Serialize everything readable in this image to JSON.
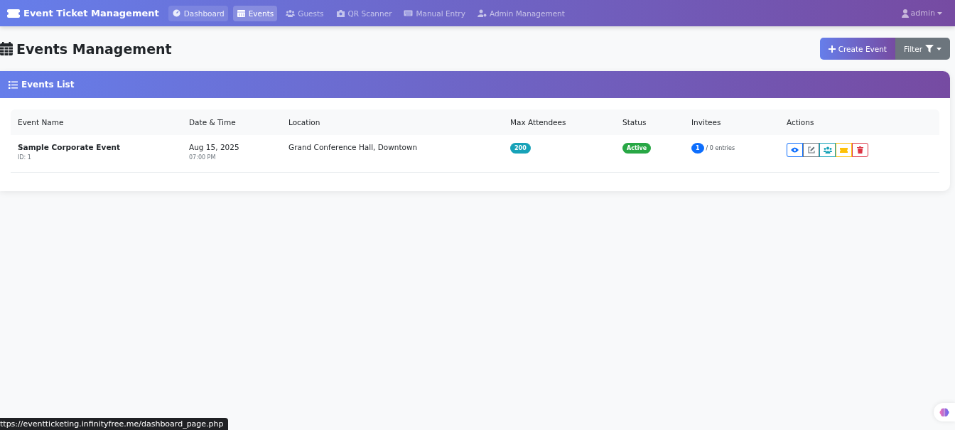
{
  "navbar": {
    "brand": "Event Ticket Management",
    "items": [
      {
        "label": "Dashboard",
        "kind": "gauge",
        "selected": false,
        "hovered": true
      },
      {
        "label": "Events",
        "kind": "calendar",
        "selected": true,
        "hovered": false
      },
      {
        "label": "Guests",
        "kind": "users",
        "selected": false,
        "hovered": false
      },
      {
        "label": "QR Scanner",
        "kind": "camera",
        "selected": false,
        "hovered": false
      },
      {
        "label": "Manual Entry",
        "kind": "keyboard",
        "selected": false,
        "hovered": false
      },
      {
        "label": "Admin Management",
        "kind": "user-gear",
        "selected": false,
        "hovered": false
      }
    ],
    "user": "admin"
  },
  "page": {
    "title": "Events Management",
    "create_button": "Create Event",
    "filter_button": "Filter"
  },
  "card": {
    "title": "Events List",
    "table": {
      "columns": [
        "Event Name",
        "Date & Time",
        "Location",
        "Max Attendees",
        "Status",
        "Invitees",
        "Actions"
      ],
      "rows": [
        {
          "name": "Sample Corporate Event",
          "id": "ID: 1",
          "date": "Aug 15, 2025",
          "time": "07:00 PM",
          "location": "Grand Conference Hall, Downtown",
          "max_attendees": "200",
          "status": "Active",
          "invitee_count": "1",
          "entries": "/ 0 entries",
          "actions": [
            {
              "kind": "view",
              "color": "#0d6efd"
            },
            {
              "kind": "edit",
              "color": "#6c757d"
            },
            {
              "kind": "guests",
              "color": "#17a2b8"
            },
            {
              "kind": "ticket",
              "color": "#ffc107"
            },
            {
              "kind": "delete",
              "color": "#dc3545"
            }
          ]
        }
      ]
    }
  },
  "status_bar": {
    "url": "ttps://eventticketing.infinityfree.me/dashboard_page.php"
  }
}
